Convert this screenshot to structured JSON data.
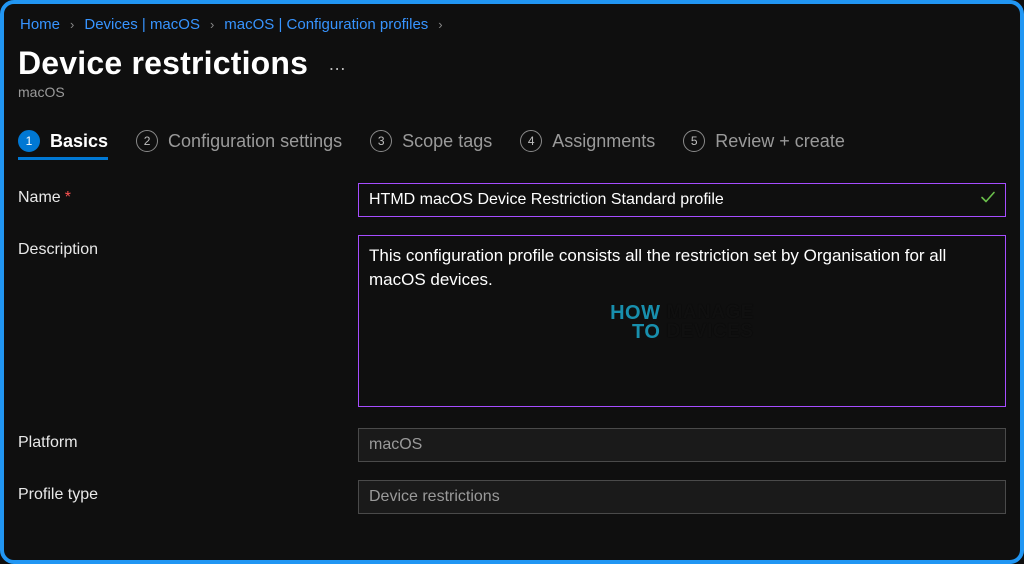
{
  "breadcrumb": {
    "items": [
      "Home",
      "Devices | macOS",
      "macOS | Configuration profiles"
    ]
  },
  "header": {
    "title": "Device restrictions",
    "subtitle": "macOS",
    "more": "…"
  },
  "wizard": {
    "steps": [
      {
        "num": "1",
        "label": "Basics",
        "active": true
      },
      {
        "num": "2",
        "label": "Configuration settings",
        "active": false
      },
      {
        "num": "3",
        "label": "Scope tags",
        "active": false
      },
      {
        "num": "4",
        "label": "Assignments",
        "active": false
      },
      {
        "num": "5",
        "label": "Review + create",
        "active": false
      }
    ]
  },
  "form": {
    "name": {
      "label": "Name",
      "required_marker": "*",
      "value": "HTMD macOS Device Restriction Standard profile",
      "valid": true
    },
    "description": {
      "label": "Description",
      "value": "This configuration profile consists all the restriction set by Organisation for all macOS devices."
    },
    "platform": {
      "label": "Platform",
      "value": "macOS"
    },
    "profile_type": {
      "label": "Profile type",
      "value": "Device restrictions"
    }
  },
  "watermark": {
    "left_line1": "HOW",
    "left_line2": "TO",
    "right_line1": "MANAGE",
    "right_line2": "DEVICES"
  },
  "colors": {
    "accent_link": "#3794ff",
    "step_active": "#0078d4",
    "field_border_active": "#a64dff",
    "valid_check": "#6abf4b",
    "frame_border": "#2196f3",
    "required": "#ff5252"
  }
}
